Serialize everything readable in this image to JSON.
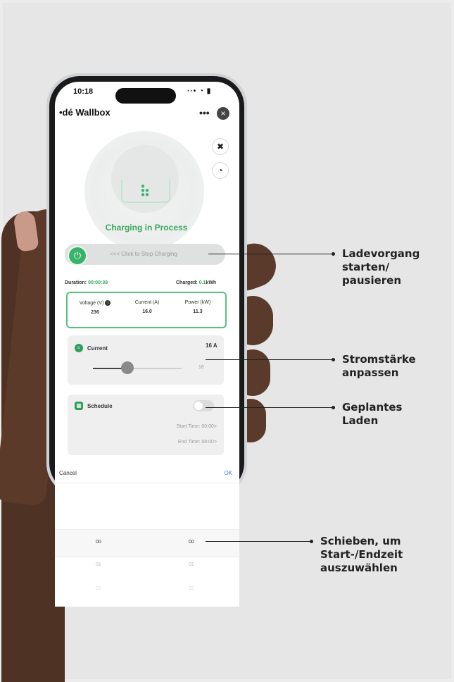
{
  "status_bar": {
    "time": "10:18",
    "icons": "··• ◔ ▮"
  },
  "app": {
    "title": "•dé Wallbox",
    "more": "•••",
    "close": "×"
  },
  "tools": {
    "fan": "✖",
    "timer": "◔"
  },
  "charging": {
    "status": "Charging in Process",
    "stop_label": "<<< Click to Stop Charging",
    "power_icon": "⏻",
    "duration_label": "Duration:",
    "duration_value": "00:00:38",
    "charged_label": "Charged:",
    "charged_value": "0.1",
    "charged_unit": "kWh"
  },
  "stats": [
    {
      "label": "Voltage (V)",
      "value": "236"
    },
    {
      "label": "Current (A)",
      "value": "16.0"
    },
    {
      "label": "Power (kW)",
      "value": "11.3"
    }
  ],
  "current_card": {
    "title": "Current",
    "value": "16 A",
    "slider_min_label": "16",
    "icon": "≈",
    "level_fraction": 0.38
  },
  "schedule_card": {
    "title": "Schedule",
    "start": "Start Time: 00:00>",
    "end": "End Time: 08:00>",
    "icon": "▦",
    "enabled": false
  },
  "picker": {
    "cancel": "Cancel",
    "ok": "OK",
    "rows": [
      {
        "left": "00",
        "right": "00"
      },
      {
        "left": "01",
        "right": "01"
      },
      {
        "left": "02",
        "right": "02"
      }
    ]
  },
  "callouts": {
    "charge": [
      "Ladevorgang",
      "starten/",
      "pausieren"
    ],
    "current": [
      "Stromstärke",
      "anpassen"
    ],
    "schedule": [
      "Geplantes",
      "Laden"
    ],
    "picker": [
      "Schieben, um",
      "Start-/Endzeit",
      "auszuwählen"
    ]
  },
  "colors": {
    "accent": "#3aa85f",
    "text": "#222222",
    "background": "#e6e6e6"
  }
}
